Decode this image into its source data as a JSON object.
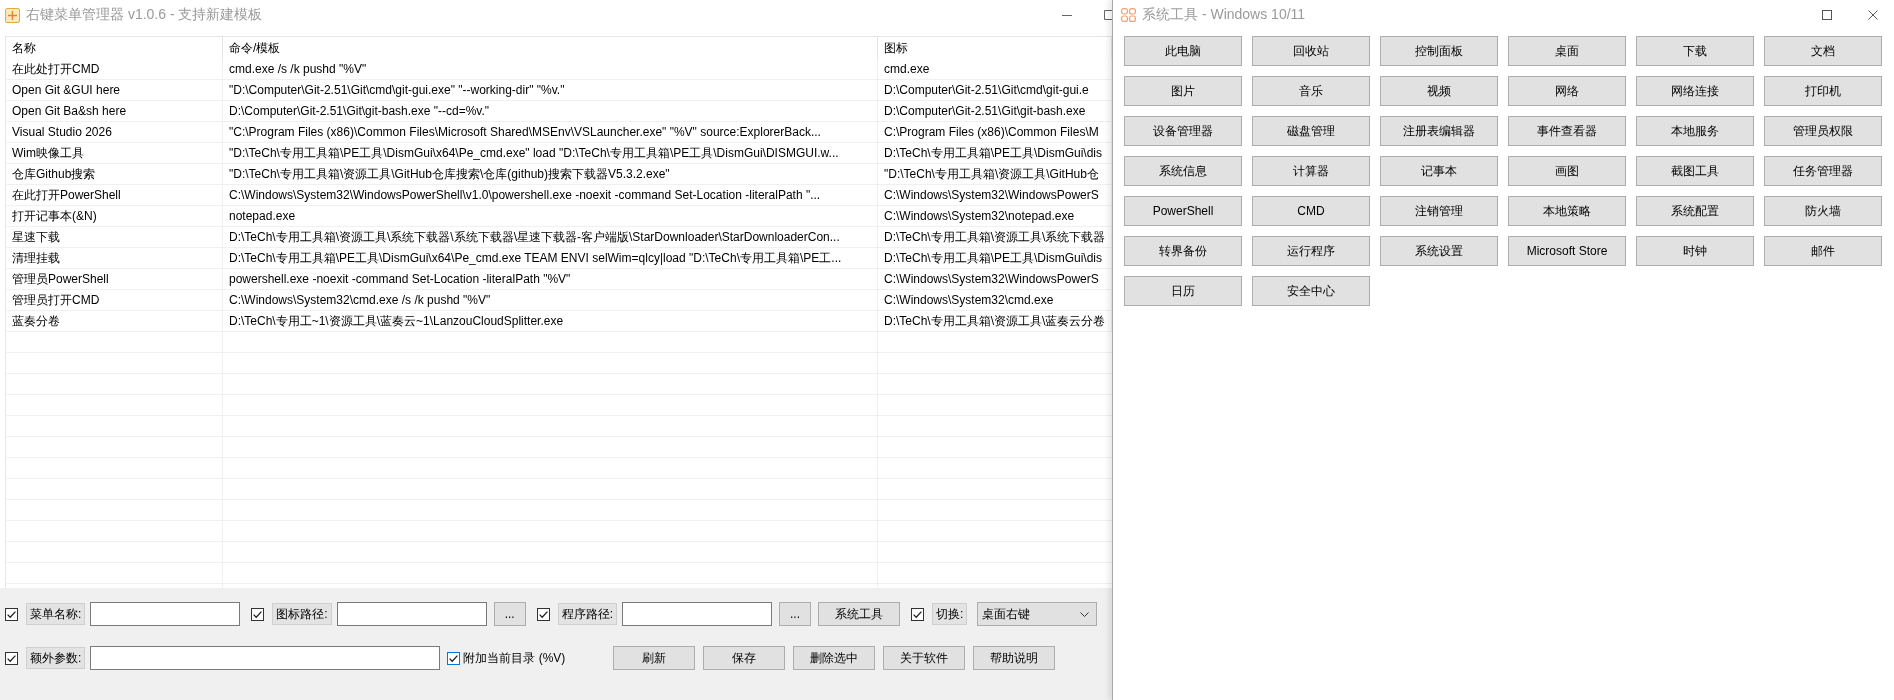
{
  "main_window": {
    "title": "右键菜单管理器 v1.0.6 - 支持新建模板"
  },
  "table": {
    "columns": [
      "名称",
      "命令/模板",
      "图标"
    ],
    "rows": [
      {
        "name": "在此处打开CMD",
        "command": "cmd.exe /s /k pushd \"%V\"",
        "icon": "cmd.exe"
      },
      {
        "name": "Open Git &GUI here",
        "command": "\"D:\\Computer\\Git-2.51\\Git\\cmd\\git-gui.exe\" \"--working-dir\" \"%v.\"",
        "icon": "D:\\Computer\\Git-2.51\\Git\\cmd\\git-gui.e"
      },
      {
        "name": "Open Git Ba&sh here",
        "command": "D:\\Computer\\Git-2.51\\Git\\git-bash.exe \"--cd=%v.\"",
        "icon": "D:\\Computer\\Git-2.51\\Git\\git-bash.exe"
      },
      {
        "name": "Visual Studio 2026",
        "command": "\"C:\\Program Files (x86)\\Common Files\\Microsoft Shared\\MSEnv\\VSLauncher.exe\" \"%V\" source:ExplorerBack...",
        "icon": "C:\\Program Files (x86)\\Common Files\\M"
      },
      {
        "name": "Wim映像工具",
        "command": "\"D:\\TeCh\\专用工具箱\\PE工具\\DismGui\\x64\\Pe_cmd.exe\" load \"D:\\TeCh\\专用工具箱\\PE工具\\DismGui\\DISMGUI.w...",
        "icon": "D:\\TeCh\\专用工具箱\\PE工具\\DismGui\\dis"
      },
      {
        "name": "仓库Github搜索",
        "command": "\"D:\\TeCh\\专用工具箱\\资源工具\\GitHub仓库搜索\\仓库(github)搜索下载器V5.3.2.exe\"",
        "icon": "\"D:\\TeCh\\专用工具箱\\资源工具\\GitHub仓"
      },
      {
        "name": "在此打开PowerShell",
        "command": "C:\\Windows\\System32\\WindowsPowerShell\\v1.0\\powershell.exe -noexit -command Set-Location -literalPath \"...",
        "icon": "C:\\Windows\\System32\\WindowsPowerS"
      },
      {
        "name": "打开记事本(&N)",
        "command": "notepad.exe",
        "icon": "C:\\Windows\\System32\\notepad.exe"
      },
      {
        "name": "星速下载",
        "command": "D:\\TeCh\\专用工具箱\\资源工具\\系统下载器\\系统下载器\\星速下载器-客户端版\\StarDownloader\\StarDownloaderCon...",
        "icon": "D:\\TeCh\\专用工具箱\\资源工具\\系统下载器"
      },
      {
        "name": "清理挂载",
        "command": "D:\\TeCh\\专用工具箱\\PE工具\\DismGui\\x64\\Pe_cmd.exe TEAM ENVI selWim=qlcy|load \"D:\\TeCh\\专用工具箱\\PE工...",
        "icon": "D:\\TeCh\\专用工具箱\\PE工具\\DismGui\\dis"
      },
      {
        "name": "管理员PowerShell",
        "command": "powershell.exe -noexit -command Set-Location -literalPath \"%V\"",
        "icon": "C:\\Windows\\System32\\WindowsPowerS"
      },
      {
        "name": "管理员打开CMD",
        "command": "C:\\Windows\\System32\\cmd.exe /s /k pushd \"%V\"",
        "icon": "C:\\Windows\\System32\\cmd.exe"
      },
      {
        "name": "蓝奏分卷",
        "command": "D:\\TeCh\\专用工~1\\资源工具\\蓝奏云~1\\LanzouCloudSplitter.exe",
        "icon": "D:\\TeCh\\专用工具箱\\资源工具\\蓝奏云分卷"
      }
    ]
  },
  "options_bar": {
    "rows": [
      {
        "items": [
          {
            "kind": "checkbox",
            "checked": true
          },
          {
            "kind": "label",
            "text": "菜单名称:"
          },
          {
            "kind": "field"
          },
          {
            "kind": "checkbox",
            "checked": true
          },
          {
            "kind": "label",
            "text": "图标路径:"
          },
          {
            "kind": "field"
          },
          {
            "kind": "button",
            "label": "..."
          },
          {
            "kind": "checkbox",
            "checked": true
          },
          {
            "kind": "label",
            "text": "程序路径:"
          },
          {
            "kind": "field"
          },
          {
            "kind": "button",
            "label": "..."
          },
          {
            "kind": "button",
            "label": "系统工具"
          },
          {
            "kind": "checkbox",
            "checked": true
          },
          {
            "kind": "label",
            "text": "切换:"
          },
          {
            "kind": "select",
            "value": "桌面右键"
          }
        ]
      },
      {
        "items": [
          {
            "kind": "checkbox",
            "checked": true
          },
          {
            "kind": "label",
            "text": "额外参数:"
          },
          {
            "kind": "field"
          },
          {
            "kind": "checkbox",
            "checked": true,
            "focused": true,
            "label": "附加当前目录 (%V)"
          }
        ]
      }
    ],
    "buttons": [
      "刷新",
      "保存",
      "删除选中",
      "关于软件",
      "帮助说明"
    ]
  },
  "tools_window": {
    "title": "系统工具 - Windows 10/11",
    "buttons": [
      "此电脑",
      "回收站",
      "控制面板",
      "桌面",
      "下载",
      "文档",
      "图片",
      "音乐",
      "视频",
      "网络",
      "网络连接",
      "打印机",
      "设备管理器",
      "磁盘管理",
      "注册表编辑器",
      "事件查看器",
      "本地服务",
      "管理员权限",
      "系统信息",
      "计算器",
      "记事本",
      "画图",
      "截图工具",
      "任务管理器",
      "PowerShell",
      "CMD",
      "注销管理",
      "本地策略",
      "系统配置",
      "防火墙",
      "转界备份",
      "运行程序",
      "系统设置",
      "Microsoft Store",
      "时钟",
      "邮件",
      "日历",
      "安全中心"
    ]
  }
}
